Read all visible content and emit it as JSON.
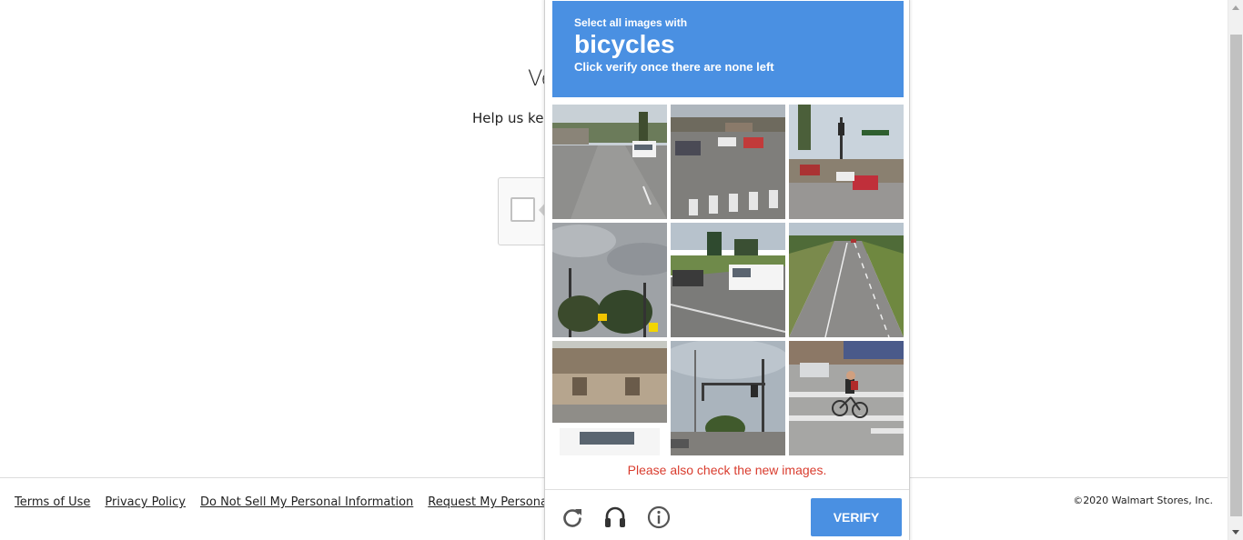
{
  "background": {
    "heading": "Ve",
    "subtext": "Help us kee"
  },
  "footer": {
    "links": [
      "Terms of Use",
      "Privacy Policy",
      "Do Not Sell My Personal Information",
      "Request My Personal In"
    ],
    "copyright": "©2020 Walmart Stores, Inc."
  },
  "challenge": {
    "prompt": "Select all images with",
    "target": "bicycles",
    "instruction": "Click verify once there are none left",
    "error": "Please also check the new images.",
    "verify_label": "VERIFY",
    "icons": [
      "reload-icon",
      "audio-headphones-icon",
      "info-icon"
    ],
    "tiles": [
      "road with white pickup truck",
      "intersection with crosswalk and cars",
      "traffic light intersection with red car",
      "cloudy sky with trees and traffic lights",
      "road with white van",
      "empty highway",
      "building with white truck",
      "street with traffic signal pole",
      "cyclist crossing street"
    ]
  },
  "colors": {
    "accent": "#4a90e2",
    "error": "#d93c2e"
  }
}
